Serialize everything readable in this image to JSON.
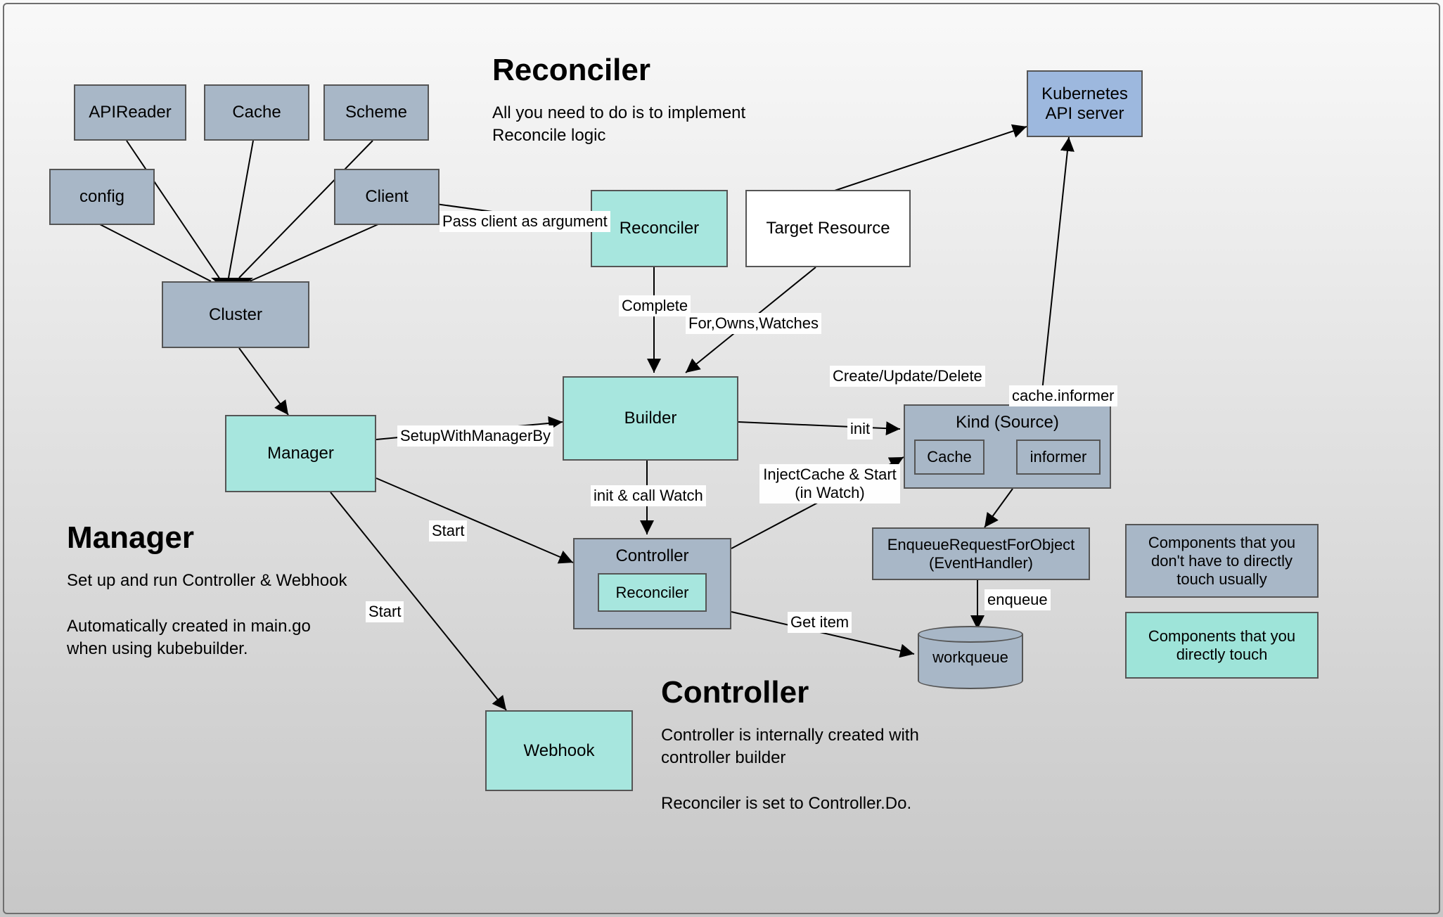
{
  "sections": {
    "reconciler": {
      "title": "Reconciler",
      "subtitle": "All you need to do is to implement Reconcile logic"
    },
    "manager": {
      "title": "Manager",
      "subtitle": "Set up and run Controller & Webhook\n\nAutomatically created in main.go when using kubebuilder."
    },
    "controller": {
      "title": "Controller",
      "subtitle": "Controller is internally created with controller builder\n\nReconciler is set to Controller.Do."
    }
  },
  "nodes": {
    "apireader": "APIReader",
    "cache": "Cache",
    "scheme": "Scheme",
    "config": "config",
    "client": "Client",
    "cluster": "Cluster",
    "manager": "Manager",
    "reconciler": "Reconciler",
    "target_resource": "Target Resource",
    "builder": "Builder",
    "controller": "Controller",
    "controller_reconciler": "Reconciler",
    "webhook": "Webhook",
    "k8s_api": "Kubernetes API server",
    "kind_source": "Kind (Source)",
    "kind_cache": "Cache",
    "kind_informer": "informer",
    "enqueue_handler": "EnqueueRequestForObject (EventHandler)",
    "workqueue": "workqueue"
  },
  "edges": {
    "pass_client": "Pass client as argument",
    "complete": "Complete",
    "for_owns_watches": "For,Owns,Watches",
    "setup_with_manager": "SetupWithManagerBy",
    "start1": "Start",
    "start2": "Start",
    "init_call_watch": "init & call Watch",
    "init": "init",
    "inject_cache": "InjectCache & Start (in Watch)",
    "create_update_delete": "Create/Update/Delete",
    "cache_informer": "cache.informer",
    "enqueue": "enqueue",
    "get_item": "Get item"
  },
  "legend": {
    "grey": "Components that you don't have to directly touch usually",
    "teal": "Components that you directly touch"
  }
}
